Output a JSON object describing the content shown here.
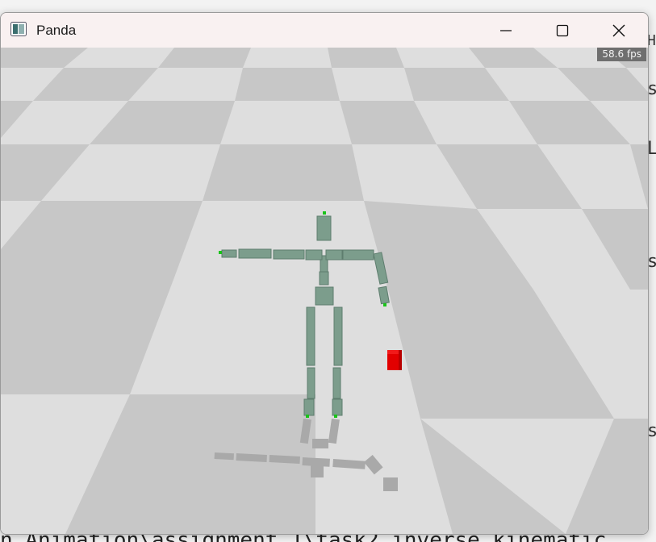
{
  "window": {
    "title": "Panda",
    "icon": "panda-app-icon",
    "controls": [
      "minimize-icon",
      "maximize-icon",
      "close-icon"
    ]
  },
  "viewport": {
    "fps_text": "58.6 fps",
    "floor_colors": {
      "light": "#dedede",
      "dark": "#c4c4c4"
    },
    "skeleton_color": "#7c9d8c",
    "joint_marker_color": "#19c419",
    "target_cube_color": "#e00000"
  },
  "background": {
    "bottom_line": "n Animation\\assignment 1\\task2 inverse kinematic",
    "right_fragments": [
      "H",
      "s",
      "L",
      "s",
      "s"
    ]
  }
}
